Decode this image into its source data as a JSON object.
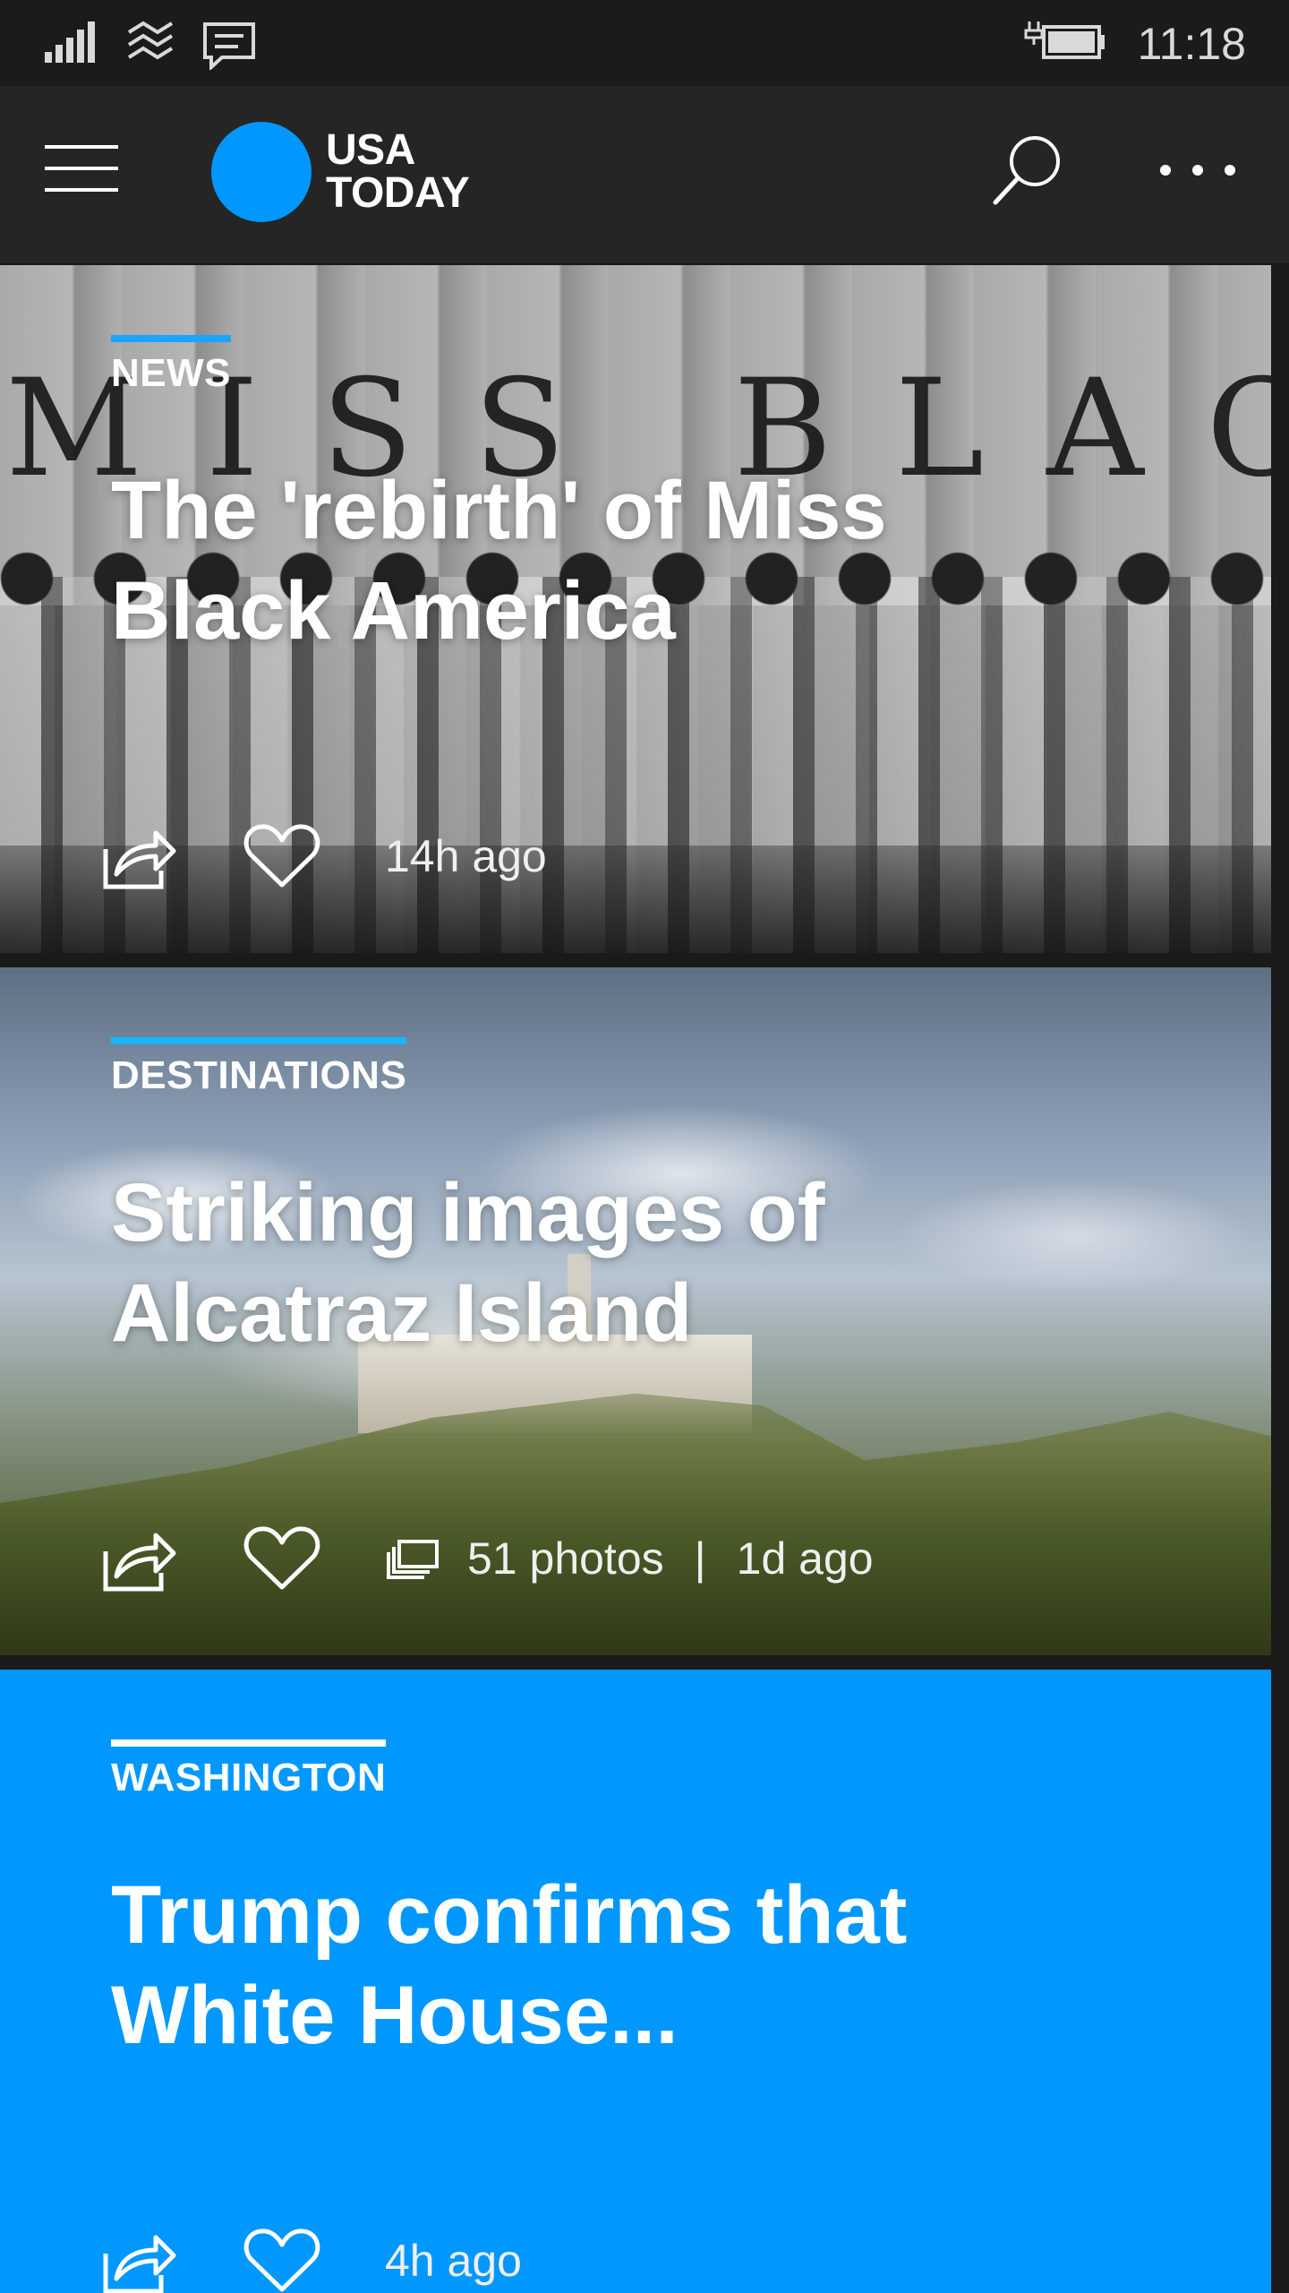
{
  "status_bar": {
    "time": "11:18",
    "icons": [
      "signal-icon",
      "wifi-icon",
      "message-icon",
      "battery-charging-icon"
    ]
  },
  "header": {
    "logo_line1": "USA",
    "logo_line2": "TODAY",
    "brand_color": "#0098fe",
    "icons": [
      "menu-icon",
      "search-icon",
      "more-icon"
    ]
  },
  "cards": [
    {
      "category": "NEWS",
      "title": "The 'rebirth' of Miss Black America",
      "time": "14h ago",
      "image_lettering": "MISS BLACK"
    },
    {
      "category": "DESTINATIONS",
      "title": "Striking images of Alcatraz Island",
      "photos": "51 photos",
      "separator": "|",
      "time": "1d ago"
    },
    {
      "category": "WASHINGTON",
      "title": "Trump confirms that White House...",
      "time": "4h ago",
      "background_color": "#0098fe"
    }
  ]
}
